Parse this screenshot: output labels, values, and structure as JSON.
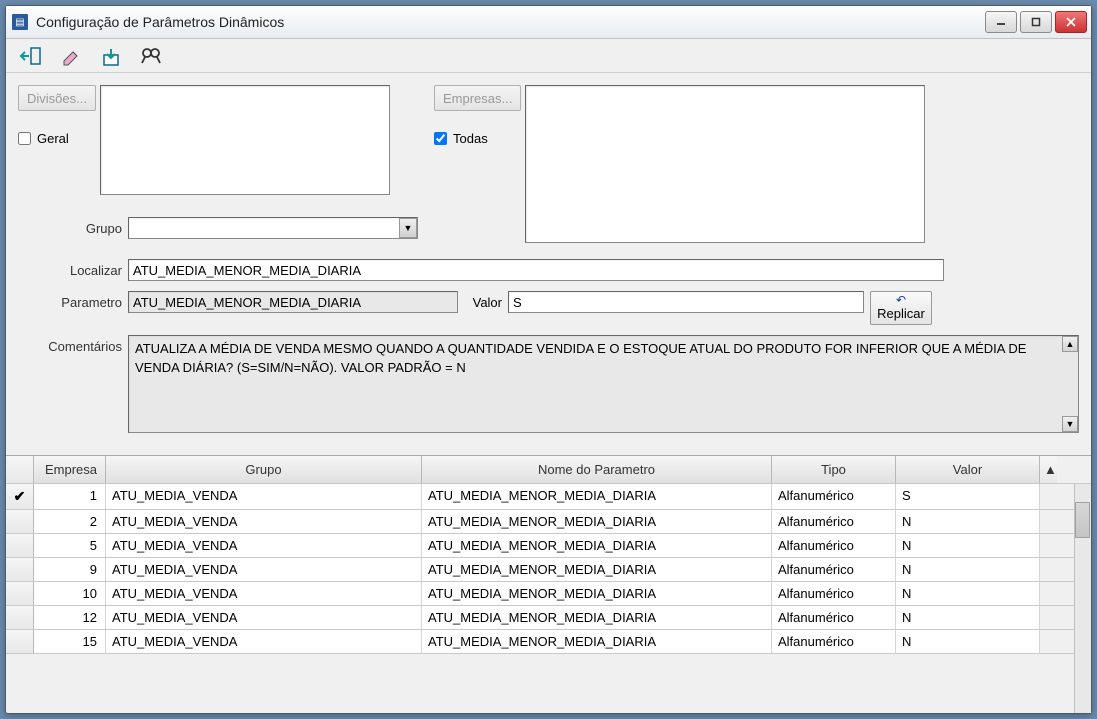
{
  "window": {
    "title": "Configuração de Parâmetros Dinâmicos"
  },
  "form": {
    "divisoes_btn": "Divisões...",
    "geral_label": "Geral",
    "geral_checked": false,
    "empresas_btn": "Empresas...",
    "todas_label": "Todas",
    "todas_checked": true,
    "grupo_label": "Grupo",
    "grupo_value": "",
    "localizar_label": "Localizar",
    "localizar_value": "ATU_MEDIA_MENOR_MEDIA_DIARIA",
    "parametro_label": "Parametro",
    "parametro_value": "ATU_MEDIA_MENOR_MEDIA_DIARIA",
    "valor_label": "Valor",
    "valor_value": "S",
    "replicar_label": "Replicar",
    "comentarios_label": "Comentários",
    "comentarios_value": "ATUALIZA A MÉDIA DE VENDA MESMO QUANDO A QUANTIDADE VENDIDA E O ESTOQUE ATUAL DO PRODUTO FOR INFERIOR QUE A MÉDIA DE VENDA DIÁRIA? (S=SIM/N=NÃO). VALOR PADRÃO = N"
  },
  "grid": {
    "headers": {
      "empresa": "Empresa",
      "grupo": "Grupo",
      "parametro": "Nome do Parametro",
      "tipo": "Tipo",
      "valor": "Valor"
    },
    "rows": [
      {
        "selected": true,
        "empresa": "1",
        "grupo": "ATU_MEDIA_VENDA",
        "parametro": "ATU_MEDIA_MENOR_MEDIA_DIARIA",
        "tipo": "Alfanumérico",
        "valor": "S"
      },
      {
        "selected": false,
        "empresa": "2",
        "grupo": "ATU_MEDIA_VENDA",
        "parametro": "ATU_MEDIA_MENOR_MEDIA_DIARIA",
        "tipo": "Alfanumérico",
        "valor": "N"
      },
      {
        "selected": false,
        "empresa": "5",
        "grupo": "ATU_MEDIA_VENDA",
        "parametro": "ATU_MEDIA_MENOR_MEDIA_DIARIA",
        "tipo": "Alfanumérico",
        "valor": "N"
      },
      {
        "selected": false,
        "empresa": "9",
        "grupo": "ATU_MEDIA_VENDA",
        "parametro": "ATU_MEDIA_MENOR_MEDIA_DIARIA",
        "tipo": "Alfanumérico",
        "valor": "N"
      },
      {
        "selected": false,
        "empresa": "10",
        "grupo": "ATU_MEDIA_VENDA",
        "parametro": "ATU_MEDIA_MENOR_MEDIA_DIARIA",
        "tipo": "Alfanumérico",
        "valor": "N"
      },
      {
        "selected": false,
        "empresa": "12",
        "grupo": "ATU_MEDIA_VENDA",
        "parametro": "ATU_MEDIA_MENOR_MEDIA_DIARIA",
        "tipo": "Alfanumérico",
        "valor": "N"
      },
      {
        "selected": false,
        "empresa": "15",
        "grupo": "ATU_MEDIA_VENDA",
        "parametro": "ATU_MEDIA_MENOR_MEDIA_DIARIA",
        "tipo": "Alfanumérico",
        "valor": "N"
      }
    ]
  }
}
